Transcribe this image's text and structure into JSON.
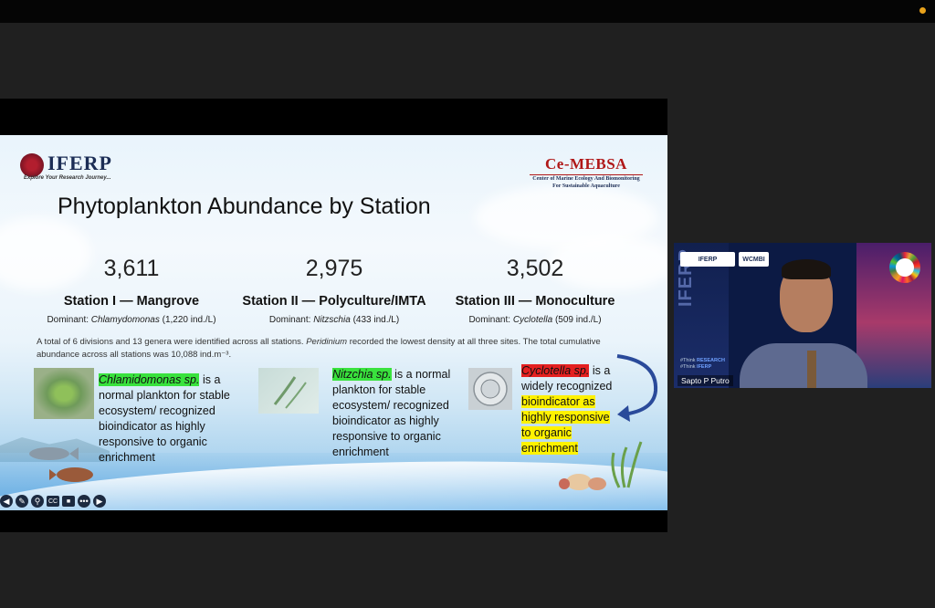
{
  "slide": {
    "logo_left": {
      "name": "IFERP",
      "tagline": "Explore Your Research Journey..."
    },
    "logo_right": {
      "name": "Ce-MEBSA",
      "line1": "Center of Marine Ecology And Biomonitoring",
      "line2": "For Sustainable Aquaculture"
    },
    "title": "Phytoplankton Abundance by Station",
    "stations": [
      {
        "value": "3,611",
        "name": "Station I — Mangrove",
        "dominant_label": "Dominant:",
        "dominant_genus": "Chlamydomonas",
        "dominant_count": "(1,220 ind./L)"
      },
      {
        "value": "2,975",
        "name": "Station II — Polyculture/IMTA",
        "dominant_label": "Dominant:",
        "dominant_genus": "Nitzschia",
        "dominant_count": "(433 ind./L)"
      },
      {
        "value": "3,502",
        "name": "Station III — Monoculture",
        "dominant_label": "Dominant:",
        "dominant_genus": "Cyclotella",
        "dominant_count": "(509 ind./L)"
      }
    ],
    "note": {
      "part1": "A total of 6 divisions and 13 genera were identified across all stations.",
      "italic": "Peridinium",
      "part2": "recorded the lowest density at all three sites. The total cumulative abundance across all stations was 10,088 ind.m⁻³."
    },
    "notes": [
      {
        "highlight": "Chlamidomonas sp.",
        "text": "is a normal plankton for stable ecosystem/ recognized bioindicator as highly responsive to organic enrichment"
      },
      {
        "highlight": "Nitzchia sp.",
        "text": "is a normal plankton for stable ecosystem/ recognized bioindicator as highly responsive to organic enrichment"
      },
      {
        "highlight": "Cyclotella sp.",
        "text_plain": "is a widely recognized",
        "text_yellow": "bioindicator as highly responsive to organic enrichment"
      }
    ]
  },
  "toolbar": {
    "icons": [
      "back-arrow-icon",
      "pen-icon",
      "zoom-icon",
      "captions-icon",
      "camera-icon",
      "more-icon",
      "forward-arrow-icon"
    ],
    "cc": "CC"
  },
  "video": {
    "participant_name": "Sapto P Putro",
    "side_text": "IFERP",
    "chip1": "IFERP",
    "chip2": "WCMBI",
    "think1_prefix": "#Think",
    "think1_word": "RESEARCH",
    "think2_prefix": "#Think",
    "think2_word": "IFERP"
  },
  "colors": {
    "green_highlight": "#39e23d",
    "red_highlight": "#e42020",
    "yellow_highlight": "#fff200",
    "recording_dot": "#e8a21b"
  }
}
